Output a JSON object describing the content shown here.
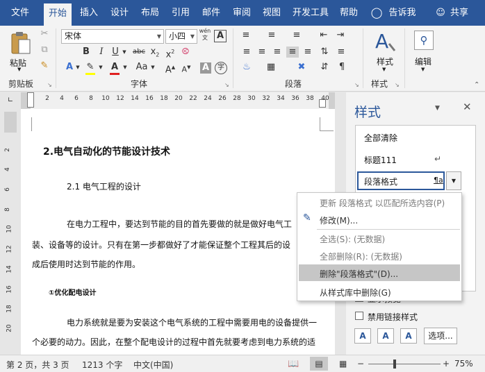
{
  "menu": {
    "file": "文件",
    "tabs": [
      "开始",
      "插入",
      "设计",
      "布局",
      "引用",
      "邮件",
      "审阅",
      "视图",
      "开发工具",
      "帮助"
    ],
    "tell": "告诉我",
    "share": "共享"
  },
  "ribbon": {
    "paste": "粘贴",
    "font_name": "宋体",
    "font_size": "小四",
    "wen": "wén",
    "styles": "样式",
    "edit": "编辑",
    "groups": {
      "clipboard": "剪贴板",
      "font": "字体",
      "paragraph": "段落",
      "styles": "样式"
    }
  },
  "ruler": {
    "h": [
      "2",
      "4",
      "6",
      "8",
      "10",
      "12",
      "14",
      "16",
      "18",
      "20",
      "22",
      "24",
      "26",
      "28",
      "30",
      "32",
      "34",
      "36",
      "38",
      "40"
    ],
    "v": [
      "2",
      "4",
      "6",
      "8",
      "10",
      "12",
      "14",
      "16",
      "18",
      "20"
    ]
  },
  "doc": {
    "heading": "2.电气自动化的节能设计技术",
    "sub": "2.1 电气工程的设计",
    "p1a": "在电力工程中，要达到节能的目的首先要做的就是做好电气工",
    "p1b": "装、设备等的设计。只有在第一步都做好了才能保证整个工程其后的设",
    "p1c": "成后使用时达到节能的作用。",
    "h3": "①优化配电设计",
    "p2a": "电力系统就是要为安装这个电气系统的工程中需要用电的设备提供一",
    "p2b": "个必要的动力。因此，在整个配电设计的过程中首先就要考虑到电力系统的适"
  },
  "pane": {
    "title": "样式",
    "styles": [
      "全部清除",
      "标题111",
      "段落格式"
    ],
    "pilcrow": "¶a",
    "check1": "显示预览",
    "check2": "禁用链接样式",
    "options": "选项..."
  },
  "context_menu": [
    {
      "label": "更新 段落格式 以匹配所选内容(P)",
      "disabled": true
    },
    {
      "label": "修改(M)...",
      "disabled": false
    },
    {
      "label": "全选(S): (无数据)",
      "disabled": true
    },
    {
      "label": "全部删除(R): (无数据)",
      "disabled": true
    },
    {
      "label": "删除\"段落格式\"(D)...",
      "disabled": false,
      "highlighted": true
    },
    {
      "label": "从样式库中删除(G)",
      "disabled": false
    }
  ],
  "status": {
    "page": "第 2 页，共 3 页",
    "words": "1213 个字",
    "lang": "中文(中国)",
    "zoom": "75%"
  },
  "colors": {
    "accent": "#2b579a",
    "highlight": "#c6c6c6",
    "font_red": "#e02020",
    "hl_yellow": "#ffff00"
  }
}
